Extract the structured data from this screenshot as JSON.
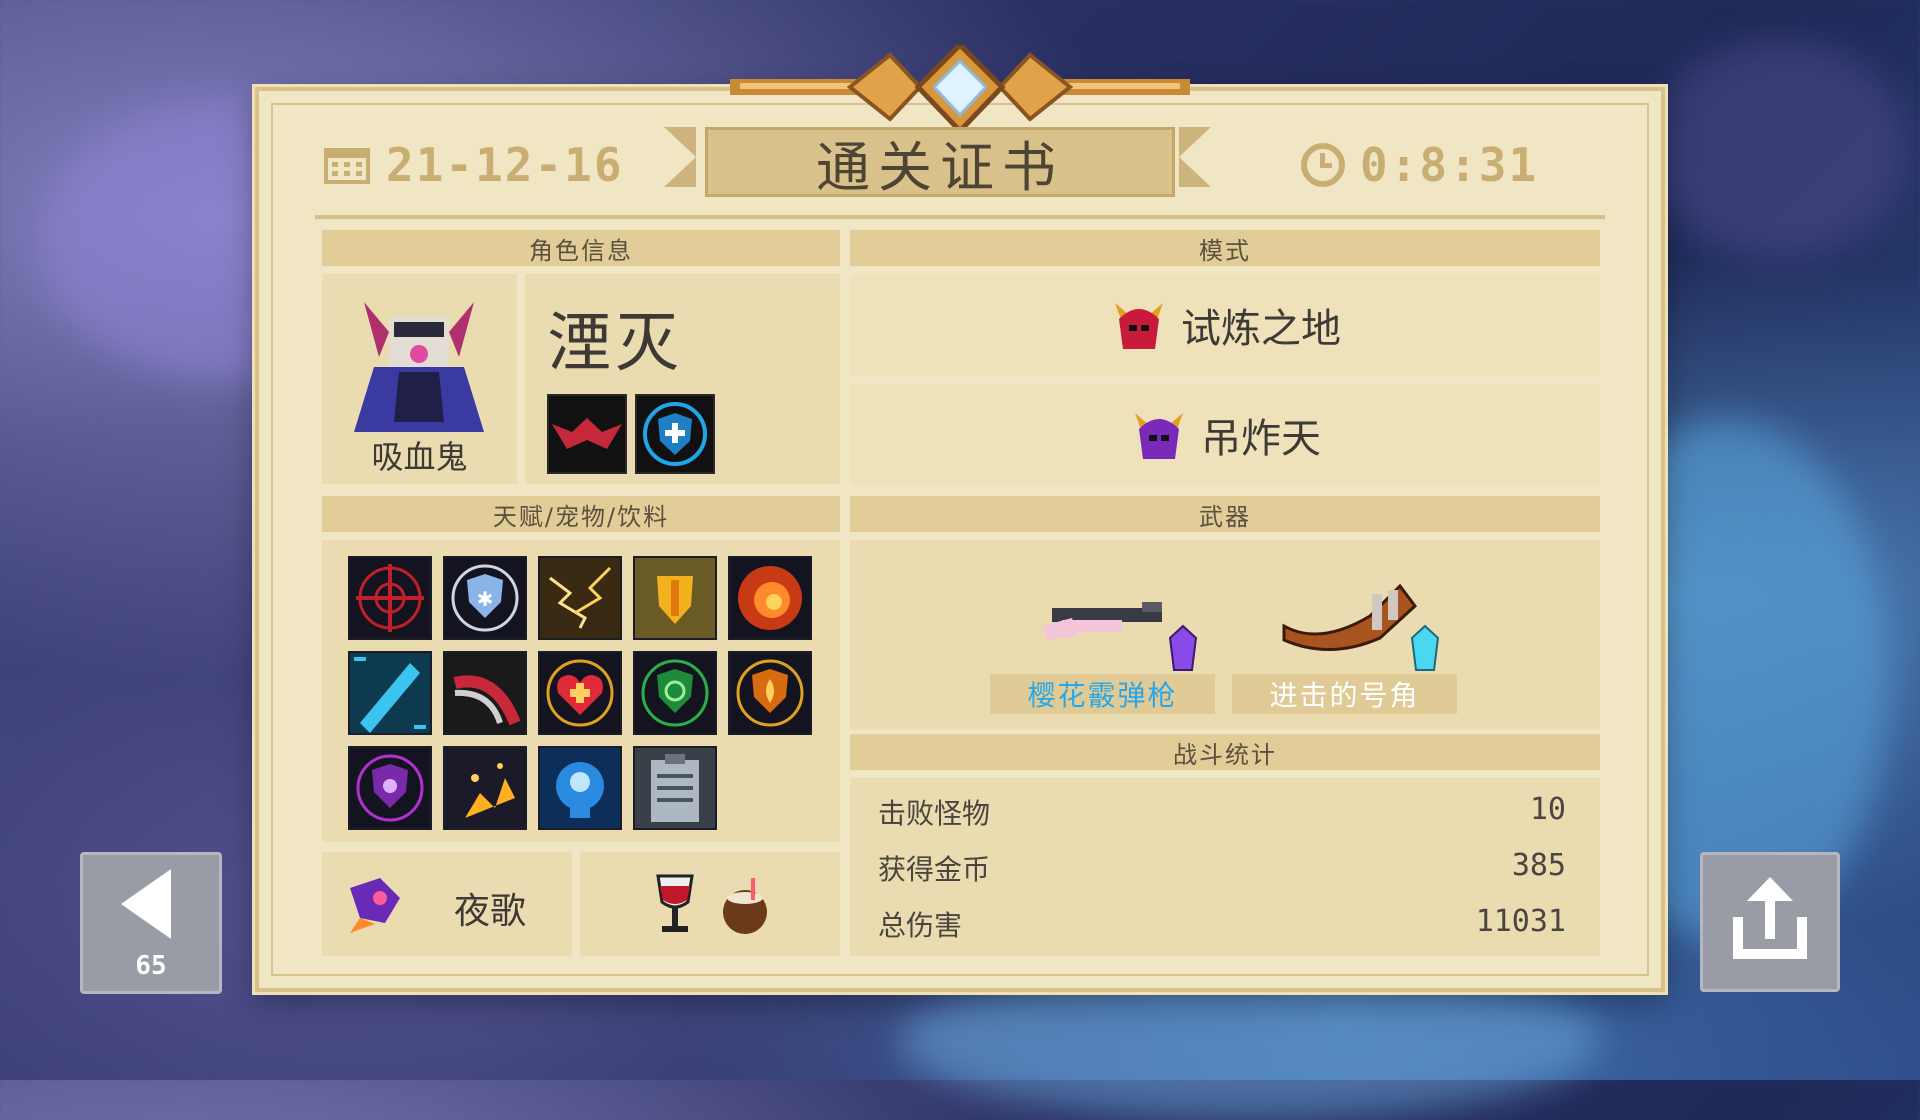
{
  "certificate": {
    "date": "21-12-16",
    "title": "通关证书",
    "time": "0:8:31"
  },
  "sections": {
    "character": "角色信息",
    "mode": "模式",
    "talents": "天赋/宠物/饮料",
    "weapons": "武器",
    "battle_stats": "战斗统计"
  },
  "character": {
    "class_name": "吸血鬼",
    "skin_name": "湮灭",
    "skills": [
      "bat-skill-icon",
      "shield-skill-icon"
    ]
  },
  "modes": [
    {
      "label": "试炼之地",
      "icon": "red-demon-helmet-icon"
    },
    {
      "label": "吊炸天",
      "icon": "purple-demon-helmet-icon"
    }
  ],
  "talents": [
    "crosshair-talent-icon",
    "snowflake-shield-talent-icon",
    "lightning-talent-icon",
    "golden-shield-talent-icon",
    "fire-swirl-talent-icon",
    "blue-blade-talent-icon",
    "red-slash-talent-icon",
    "heart-heal-talent-icon",
    "green-shield-talent-icon",
    "orange-flame-shield-talent-icon",
    "purple-shield-talent-icon",
    "explosion-talent-icon",
    "blue-mind-talent-icon",
    "clipboard-talent-icon"
  ],
  "pet": {
    "label": "夜歌",
    "icon": "nightingale-pet-icon"
  },
  "drinks": [
    "wine-glass-icon",
    "coconut-drink-icon"
  ],
  "weapons": [
    {
      "label": "樱花霰弹枪",
      "icon": "sakura-shotgun-icon",
      "gem": "purple-gem-icon",
      "label_color": "#2aa7e8"
    },
    {
      "label": "进击的号角",
      "icon": "horn-icon",
      "gem": "cyan-gem-icon",
      "label_color": "#ffffff"
    }
  ],
  "stats": [
    {
      "label": "击败怪物",
      "value": "10"
    },
    {
      "label": "获得金币",
      "value": "385"
    },
    {
      "label": "总伤害",
      "value": "11031"
    }
  ],
  "nav": {
    "back_count": "65"
  }
}
